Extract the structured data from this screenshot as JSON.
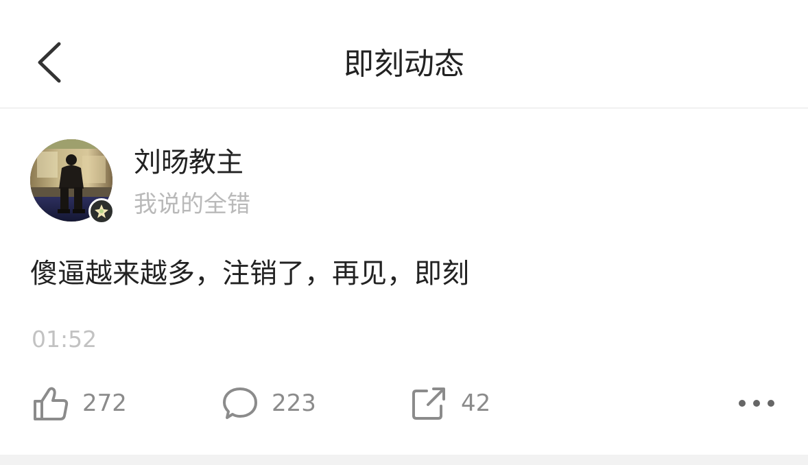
{
  "header": {
    "title": "即刻动态",
    "back_icon": "chevron-left-icon"
  },
  "author": {
    "name": "刘旸教主",
    "bio": "我说的全错",
    "badge_icon": "flower-badge-icon"
  },
  "post": {
    "text": "傻逼越来越多，注销了，再见，即刻",
    "time": "01:52"
  },
  "actions": {
    "like_count": "272",
    "comment_count": "223",
    "share_count": "42",
    "like_icon": "thumbs-up-icon",
    "comment_icon": "speech-bubble-icon",
    "share_icon": "share-out-icon",
    "more_icon": "more-dots-icon"
  },
  "colors": {
    "primary_text": "#222222",
    "secondary_text": "#b9b9b9",
    "icon_gray": "#8b8b8b",
    "divider": "#e3e3e3"
  }
}
